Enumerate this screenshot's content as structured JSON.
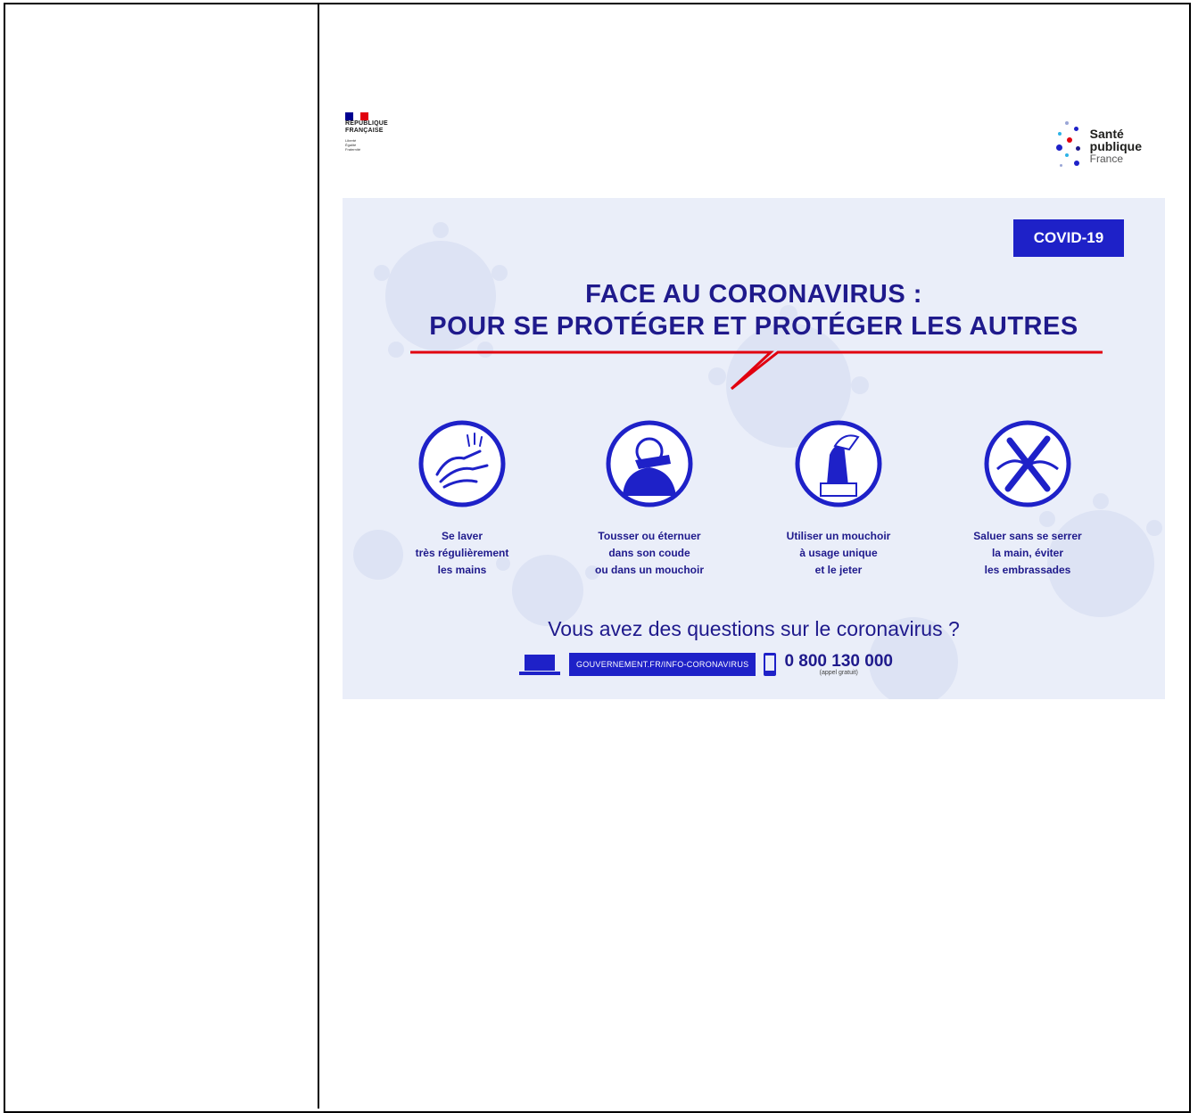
{
  "poster": {
    "republique": {
      "line1": "RÉPUBLIQUE",
      "line2": "FRANÇAISE",
      "devise": [
        "Liberté",
        "Égalité",
        "Fraternité"
      ]
    },
    "spf": {
      "line1": "Santé",
      "line2": "publique",
      "line3": "France"
    },
    "badge": "COVID-19",
    "title_line1": "FACE AU CORONAVIRUS :",
    "title_line2": "POUR SE PROTÉGER ET PROTÉGER LES AUTRES",
    "gestures": [
      {
        "icon": "handwash-icon",
        "lines": [
          "Se laver",
          "très régulièrement",
          "les mains"
        ]
      },
      {
        "icon": "cough-elbow-icon",
        "lines": [
          "Tousser ou éternuer",
          "dans son coude",
          "ou dans un mouchoir"
        ]
      },
      {
        "icon": "tissue-icon",
        "lines": [
          "Utiliser un mouchoir",
          "à usage unique",
          "et le jeter"
        ]
      },
      {
        "icon": "no-handshake-icon",
        "lines": [
          "Saluer sans se serrer",
          "la main, éviter",
          "les embrassades"
        ]
      }
    ],
    "question": "Vous avez des questions sur le coronavirus ?",
    "url": "GOUVERNEMENT.FR/INFO-CORONAVIRUS",
    "phone": "0 800 130 000",
    "phone_note": "(appel gratuit)"
  },
  "colors": {
    "navy": "#1f1a8c",
    "blue": "#1e21c8",
    "red": "#e1000f",
    "panel": "#eaeef9"
  }
}
